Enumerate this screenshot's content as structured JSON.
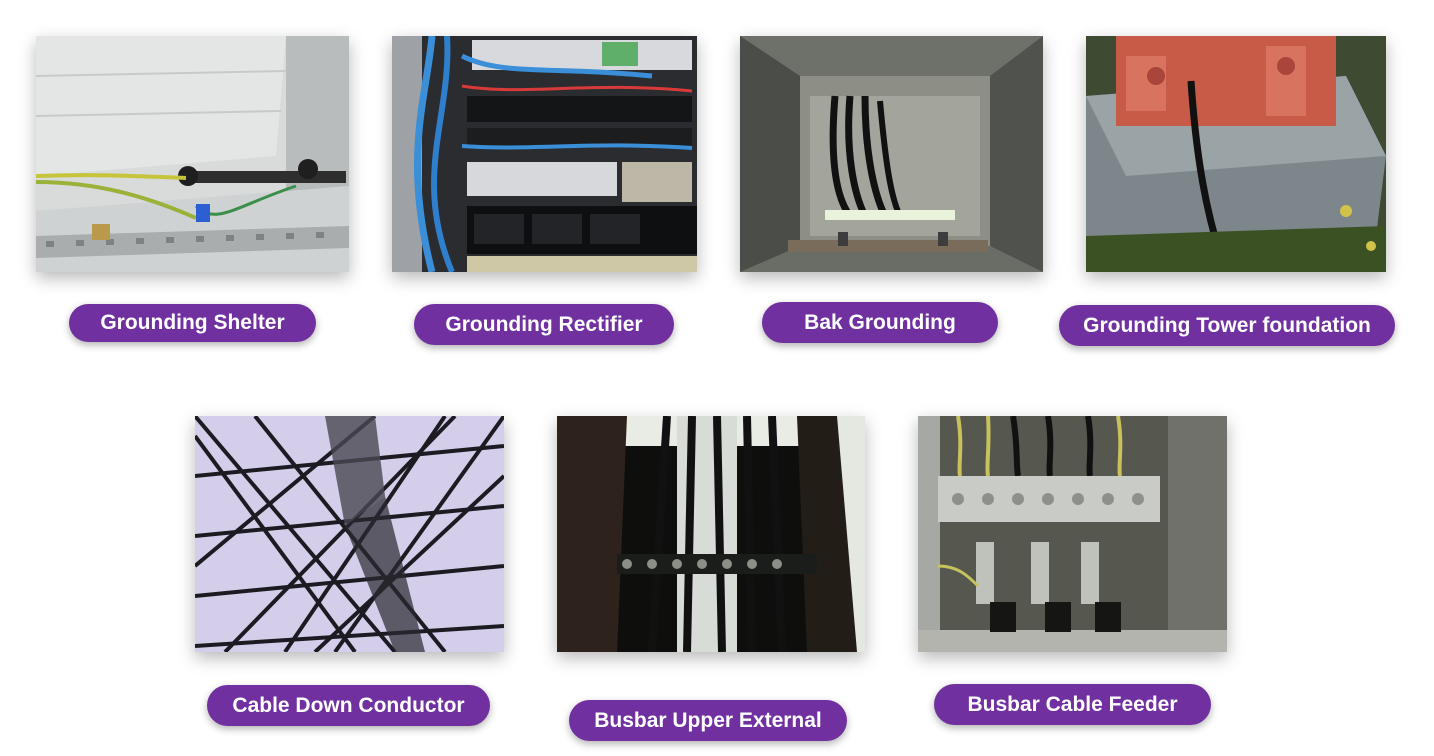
{
  "items": [
    {
      "label": "Grounding Shelter",
      "photo": "grounding-shelter-photo"
    },
    {
      "label": "Grounding Rectifier",
      "photo": "grounding-rectifier-photo"
    },
    {
      "label": "Bak Grounding",
      "photo": "bak-grounding-photo"
    },
    {
      "label": "Grounding Tower foundation",
      "photo": "grounding-tower-foundation-photo"
    },
    {
      "label": "Cable Down Conductor",
      "photo": "cable-down-conductor-photo"
    },
    {
      "label": "Busbar Upper External",
      "photo": "busbar-upper-external-photo"
    },
    {
      "label": "Busbar Cable Feeder",
      "photo": "busbar-cable-feeder-photo"
    }
  ],
  "colors": {
    "label_background": "#7030a0",
    "label_text": "#ffffff"
  }
}
